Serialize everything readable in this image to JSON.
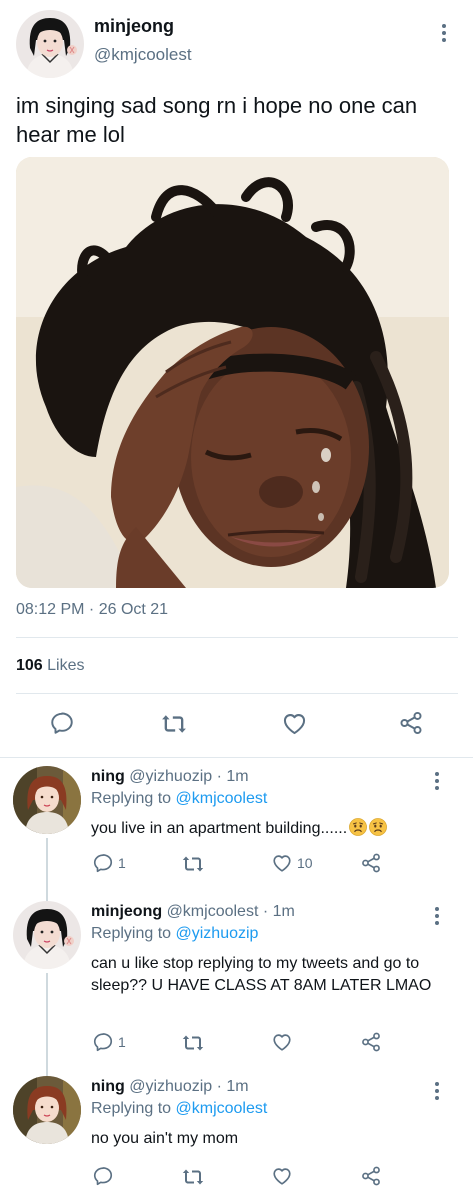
{
  "main_tweet": {
    "author_name": "minjeong",
    "author_handle": "@kmjcoolest",
    "text": "im singing sad song rn i hope no one can hear me lol",
    "timestamp": "08:12 PM · 26 Oct 21",
    "likes_count": "106",
    "likes_label": "Likes",
    "actions": [
      "reply-icon",
      "retweet-icon",
      "like-icon",
      "share-icon"
    ]
  },
  "replies": [
    {
      "author_name": "ning",
      "author_handle": "@yizhuozip",
      "separator": "·",
      "time": "1m",
      "replying_prefix": "Replying to",
      "replying_to": "@kmjcoolest",
      "text": "you live in an apartment building......",
      "emojis": [
        "worried-face-emoji",
        "worried-face-emoji"
      ],
      "reply_count": "1",
      "retweet_count": "",
      "like_count": "10"
    },
    {
      "author_name": "minjeong",
      "author_handle": "@kmjcoolest",
      "separator": "·",
      "time": "1m",
      "replying_prefix": "Replying to",
      "replying_to": "@yizhuozip",
      "text": "can u like stop replying to my tweets and go to sleep?? U HAVE CLASS AT 8AM LATER LMAO",
      "reply_count": "1",
      "retweet_count": "",
      "like_count": ""
    },
    {
      "author_name": "ning",
      "author_handle": "@yizhuozip",
      "separator": "·",
      "time": "1m",
      "replying_prefix": "Replying to",
      "replying_to": "@kmjcoolest",
      "text": "no you ain't my mom",
      "reply_count": "",
      "retweet_count": "",
      "like_count": ""
    }
  ],
  "colors": {
    "text_primary": "#0f1419",
    "text_secondary": "#5b7083",
    "link": "#1d9bf0",
    "divider": "#e1e8ed"
  }
}
